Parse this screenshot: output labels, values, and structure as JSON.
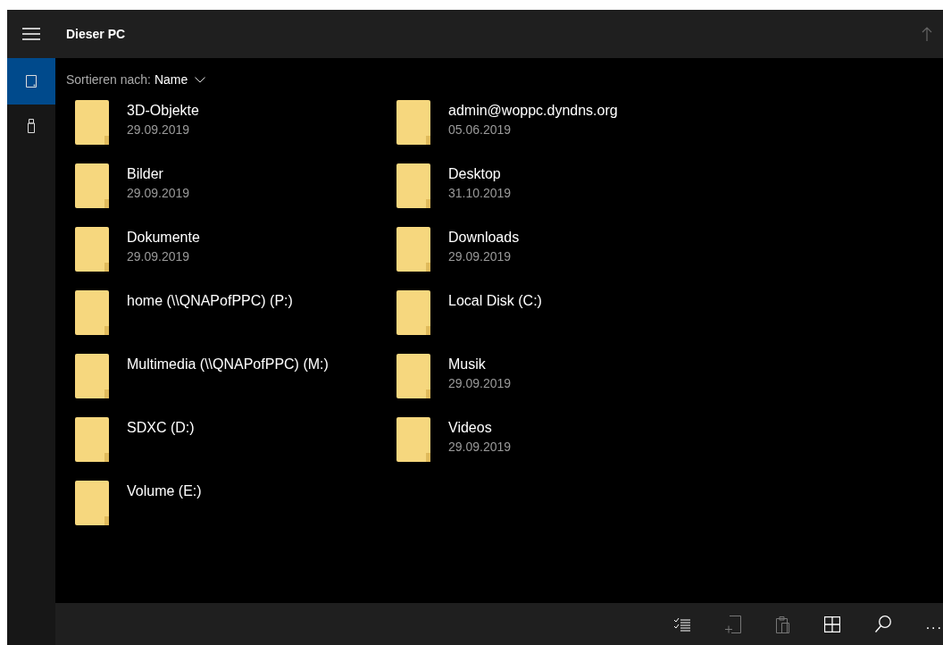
{
  "header": {
    "title": "Dieser PC",
    "up_disabled": true
  },
  "sidebar": {
    "items": [
      {
        "kind": "device",
        "selected": true
      },
      {
        "kind": "usb",
        "selected": false
      }
    ]
  },
  "sort": {
    "label": "Sortieren nach:",
    "value": "Name"
  },
  "folders": [
    {
      "name": "3D-Objekte",
      "date": "29.09.2019"
    },
    {
      "name": "admin@woppc.dyndns.org",
      "date": "05.06.2019"
    },
    {
      "name": "Bilder",
      "date": "29.09.2019"
    },
    {
      "name": "Desktop",
      "date": "31.10.2019"
    },
    {
      "name": "Dokumente",
      "date": "29.09.2019"
    },
    {
      "name": "Downloads",
      "date": "29.09.2019"
    },
    {
      "name": "home (\\\\QNAPofPPC) (P:)"
    },
    {
      "name": "Local Disk (C:)"
    },
    {
      "name": "Multimedia (\\\\QNAPofPPC) (M:)"
    },
    {
      "name": "Musik",
      "date": "29.09.2019"
    },
    {
      "name": "SDXC (D:)"
    },
    {
      "name": "Videos",
      "date": "29.09.2019"
    },
    {
      "name": "Volume (E:)"
    }
  ],
  "toolbar": [
    {
      "kind": "select",
      "disabled": false
    },
    {
      "kind": "newfolder",
      "disabled": true
    },
    {
      "kind": "paste",
      "disabled": true
    },
    {
      "kind": "view",
      "disabled": false
    },
    {
      "kind": "search",
      "disabled": false
    },
    {
      "kind": "more",
      "disabled": false,
      "label": "..."
    }
  ]
}
